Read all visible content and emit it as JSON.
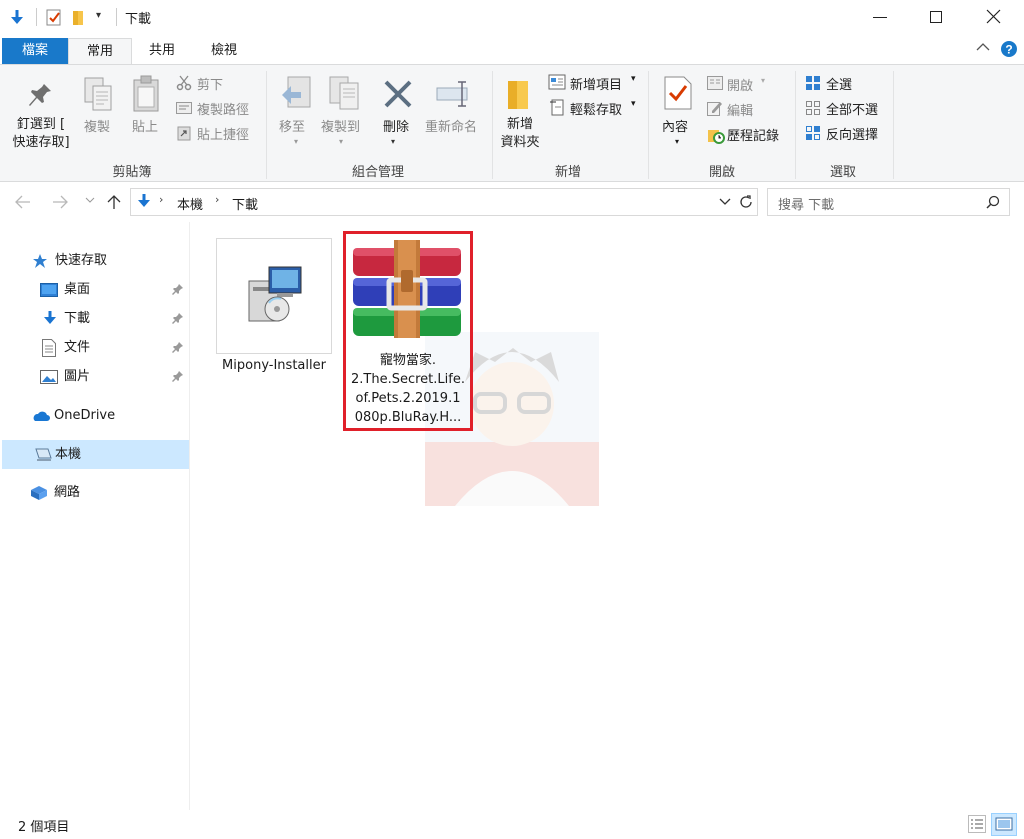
{
  "window": {
    "title": "下載"
  },
  "ribbon_tabs": [
    {
      "label": "檔案"
    },
    {
      "label": "常用"
    },
    {
      "label": "共用"
    },
    {
      "label": "檢視"
    }
  ],
  "ribbon": {
    "clipboard": {
      "pin_label_line1": "釘選到 [",
      "pin_label_line2": "快速存取]",
      "copy_label": "複製",
      "paste_label": "貼上",
      "cut_label": "剪下",
      "copy_path_label": "複製路徑",
      "paste_shortcut_label": "貼上捷徑",
      "group_label": "剪貼簿"
    },
    "organize": {
      "move_to_label": "移至",
      "copy_to_label": "複製到",
      "delete_label": "刪除",
      "rename_label": "重新命名",
      "group_label": "組合管理"
    },
    "new": {
      "new_folder_line1": "新增",
      "new_folder_line2": "資料夾",
      "new_item_label": "新增項目",
      "easy_access_label": "輕鬆存取",
      "group_label": "新增"
    },
    "open": {
      "properties_label": "內容",
      "open_label": "開啟",
      "edit_label": "編輯",
      "history_label": "歷程記錄",
      "group_label": "開啟"
    },
    "select": {
      "select_all_label": "全選",
      "select_none_label": "全部不選",
      "invert_label": "反向選擇",
      "group_label": "選取"
    }
  },
  "address": {
    "crumbs": [
      "本機",
      "下載"
    ],
    "search_placeholder": "搜尋 下載"
  },
  "nav": {
    "quick_access": "快速存取",
    "items": [
      {
        "label": "桌面"
      },
      {
        "label": "下載"
      },
      {
        "label": "文件"
      },
      {
        "label": "圖片"
      }
    ],
    "onedrive": "OneDrive",
    "this_pc": "本機",
    "network": "網路"
  },
  "files": [
    {
      "name": "Mipony-Installer"
    },
    {
      "name_lines": [
        "寵物當家.",
        "2.The.Secret.Life.",
        "of.Pets.2.2019.1",
        "080p.BluRay.H..."
      ]
    }
  ],
  "status": {
    "count_label": "2 個項目"
  },
  "colors": {
    "accent": "#1979ca",
    "highlight_border": "#e0202a",
    "nav_selected": "#cce8ff"
  }
}
